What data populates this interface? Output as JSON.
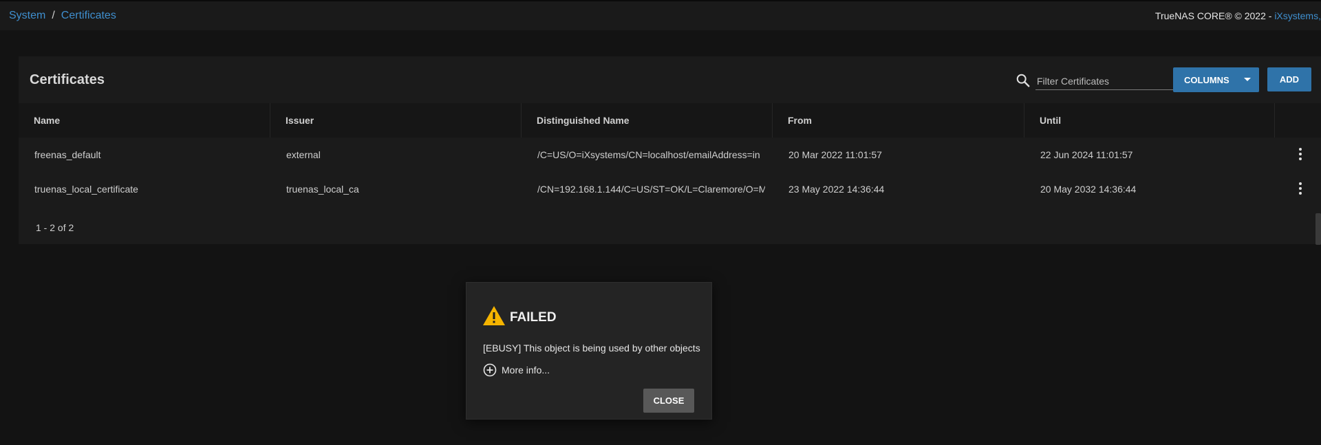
{
  "breadcrumb": {
    "parent": "System",
    "separator": "/",
    "current": "Certificates"
  },
  "footer_brand": {
    "text": "TrueNAS CORE® © 2022 - ",
    "link": "iXsystems,"
  },
  "card": {
    "title": "Certificates",
    "search": {
      "placeholder": "Filter Certificates",
      "icon": "search-icon"
    },
    "columns_button": "COLUMNS",
    "add_button": "ADD"
  },
  "table": {
    "headers": [
      "Name",
      "Issuer",
      "Distinguished Name",
      "From",
      "Until"
    ],
    "rows": [
      {
        "name": "freenas_default",
        "issuer": "external",
        "dn": "/C=US/O=iXsystems/CN=localhost/emailAddress=in",
        "from": "20 Mar 2022 11:01:57",
        "until": "22 Jun 2024 11:01:57"
      },
      {
        "name": "truenas_local_certificate",
        "issuer": "truenas_local_ca",
        "dn": "/CN=192.168.1.144/C=US/ST=OK/L=Claremore/O=M",
        "from": "23 May 2022 14:36:44",
        "until": "20 May 2032 14:36:44"
      }
    ],
    "paginator": "1 - 2 of 2"
  },
  "dialog": {
    "title": "FAILED",
    "message": "[EBUSY] This object is being used by other objects",
    "more_info": "More info...",
    "close": "CLOSE"
  },
  "colors": {
    "accent": "#2f73a9",
    "link": "#3f8fcf",
    "warning": "#f5b400",
    "background": "#131313"
  }
}
